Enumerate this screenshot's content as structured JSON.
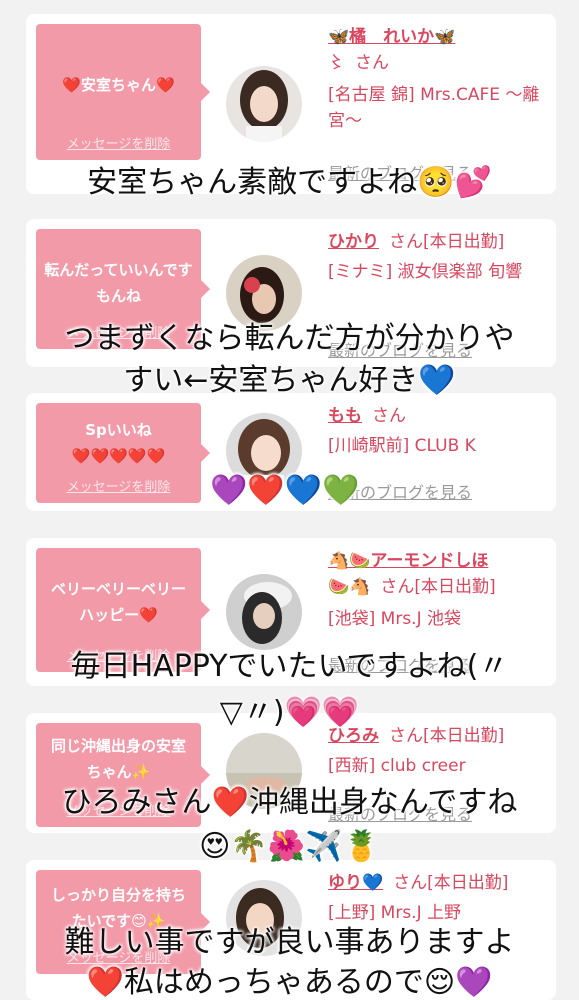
{
  "delete_label": "メッセージを削除",
  "blog_label": "最新のブログを見る",
  "cards": [
    {
      "message": "❤️安室ちゃん❤️",
      "name": "🦋橘　れいか🦋",
      "name_prefix": "〻",
      "san": "さん",
      "shop": "[名古屋 錦] Mrs.CAFE 〜離宮〜"
    },
    {
      "message": "転んだっていいんですもんね",
      "name": "ひかり",
      "san": "さん[本日出勤]",
      "shop": "[ミナミ] 淑女倶楽部 旬響"
    },
    {
      "message": "Spいいね",
      "message2": "❤️❤️❤️❤️❤️",
      "name": "もも",
      "san": "さん",
      "shop": "[川崎駅前] CLUB K"
    },
    {
      "message": "ベリーベリーベリーハッピー❤️",
      "name": "🐴🍉アーモンドしほ",
      "name_sub": "🍉🐴",
      "san": "さん[本日出勤]",
      "shop": "[池袋] Mrs.J 池袋"
    },
    {
      "message": "同じ沖縄出身の安室ちゃん✨",
      "name": "ひろみ",
      "san": "さん[本日出勤]",
      "shop": "[西新] club creer"
    },
    {
      "message": "しっかり自分を持ちたいです😊✨",
      "name": "ゆり💙",
      "san": "さん[本日出勤]",
      "shop": "[上野] Mrs.J 上野"
    }
  ],
  "overlays": {
    "o1": "安室ちゃん素敵ですよね🥺💕",
    "o2a": "つまずくなら転んだ方が分かりや",
    "o2b": "すい←安室ちゃん好き💙",
    "o3": "💜❤️💙💚",
    "o4a": "毎日HAPPYでいたいですよね(〃",
    "o4b": "▽〃)💗💗",
    "o5a": "ひろみさん❤️沖縄出身なんですね",
    "o5b": "😍🌴🌺✈️🍍",
    "o6a": "難しい事ですが良い事ありますよ",
    "o6b": "❤️私はめっちゃあるので😌💜"
  },
  "colors": {
    "bubble": "#f39aa9",
    "accent": "#d9475f",
    "background": "#f2f2f2"
  }
}
